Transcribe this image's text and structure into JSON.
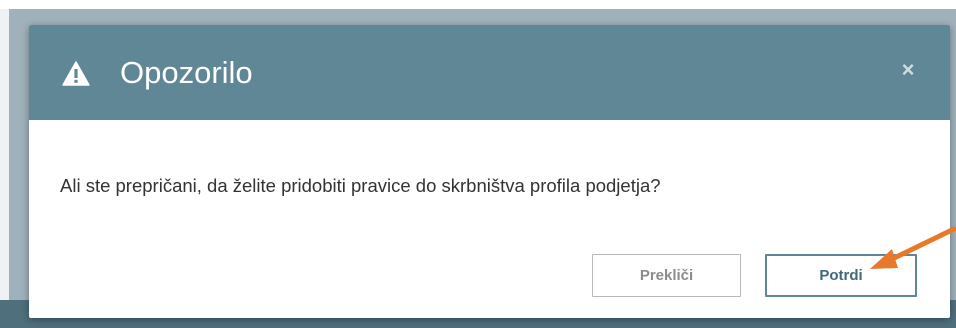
{
  "dialog": {
    "title": "Opozorilo",
    "message": "Ali ste prepričani, da želite pridobiti pravice do skrbništva profila podjetja?",
    "close_glyph": "×",
    "cancel_label": "Prekliči",
    "confirm_label": "Potrdi"
  },
  "icons": {
    "warning": "warning-icon",
    "close": "close-icon"
  },
  "colors": {
    "header": "#5f8796",
    "confirm_border": "#5f8796",
    "annotation_arrow": "#e8792b",
    "backdrop": "#9fb1ba"
  }
}
